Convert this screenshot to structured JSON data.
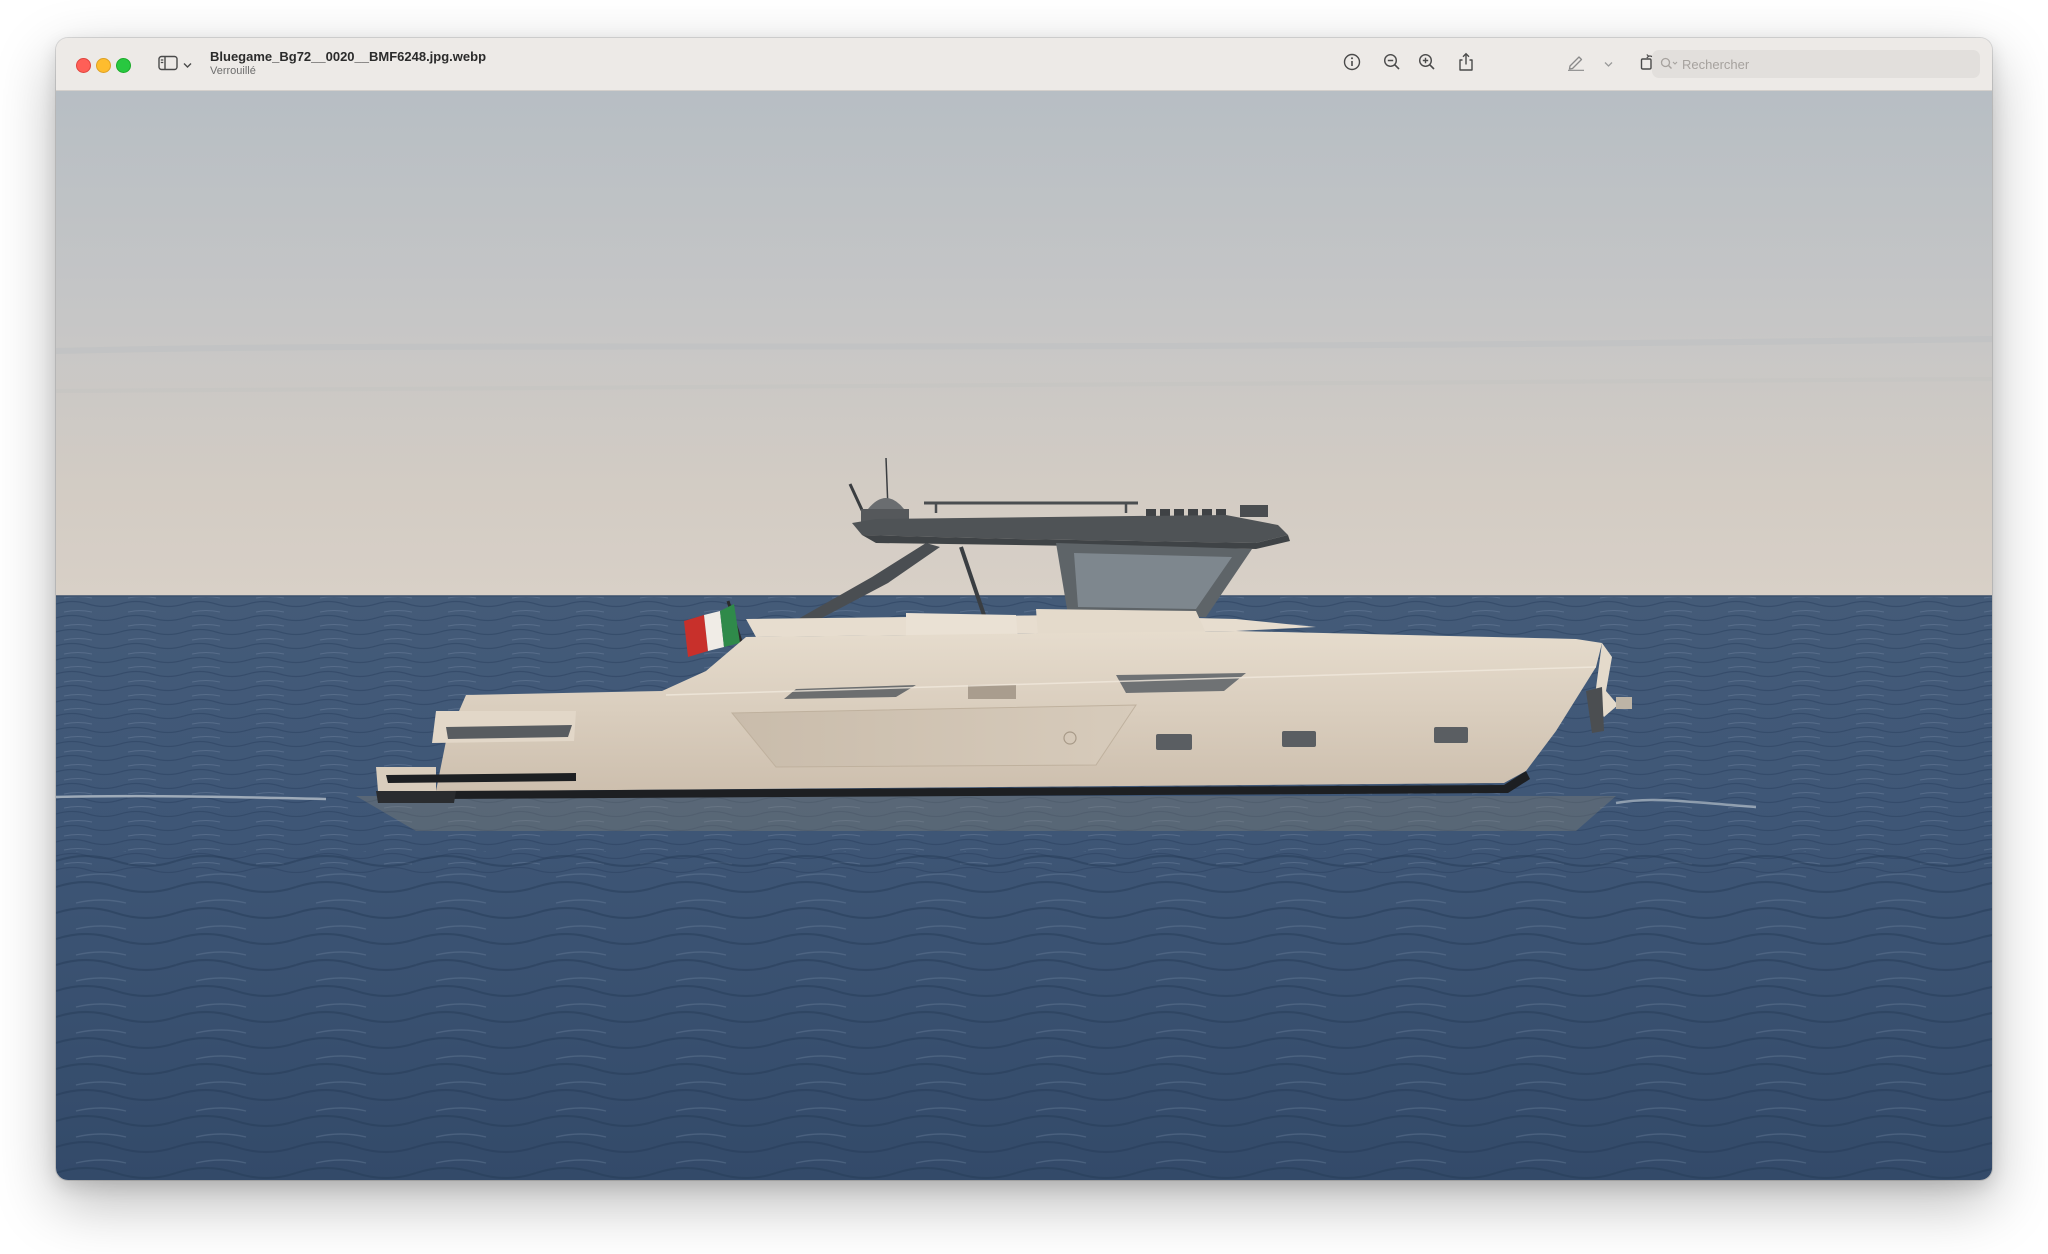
{
  "window": {
    "title": "Bluegame_Bg72__0020__BMF6248.jpg.webp",
    "subtitle": "Verrouillé"
  },
  "toolbar": {
    "icons": [
      "sidebar-icon",
      "chevron-down-icon",
      "info-icon",
      "zoom-out-icon",
      "zoom-in-icon",
      "share-icon",
      "markup-pen-icon",
      "chevron-down-icon",
      "rotate-icon",
      "annotate-icon"
    ]
  },
  "search": {
    "placeholder": "Rechercher",
    "value": ""
  },
  "image": {
    "subject": "photo",
    "colors": {
      "sky_top": "#b7bec4",
      "sky_horizon": "#d6cfc8",
      "sea": "#3d5676",
      "hull": "#dccfbe",
      "roof": "#505457"
    }
  }
}
